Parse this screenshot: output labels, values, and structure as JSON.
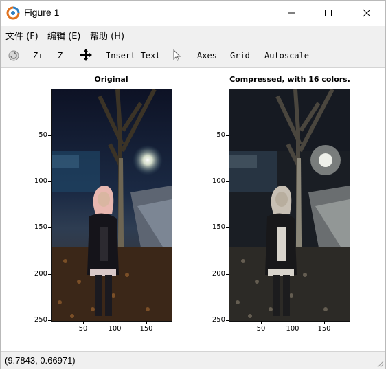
{
  "window": {
    "title": "Figure 1"
  },
  "menu": {
    "items": [
      "文件 (F)",
      "编辑 (E)",
      "帮助 (H)"
    ]
  },
  "toolbar": {
    "zoom_in": "Z+",
    "zoom_out": "Z-",
    "insert_text": "Insert Text",
    "axes": "Axes",
    "grid": "Grid",
    "autoscale": "Autoscale"
  },
  "plots": [
    {
      "title": "Original",
      "yticks": [
        "50",
        "100",
        "150",
        "200",
        "250"
      ],
      "xticks": [
        "50",
        "100",
        "150"
      ]
    },
    {
      "title": "Compressed, with 16 colors.",
      "yticks": [
        "50",
        "100",
        "150",
        "200",
        "250"
      ],
      "xticks": [
        "50",
        "100",
        "150"
      ]
    }
  ],
  "status": {
    "text": "(9.7843, 0.66971)"
  }
}
